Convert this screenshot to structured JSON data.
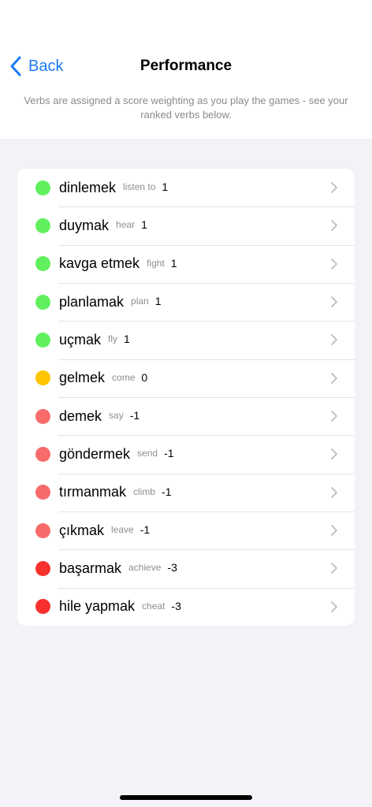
{
  "nav": {
    "back_label": "Back",
    "title": "Performance",
    "back_color": "#1a7cf5"
  },
  "description": "Verbs are assigned a score weighting as you play the games - see your ranked verbs below.",
  "colors": {
    "green": "#60f05d",
    "yellow": "#fdc500",
    "light_red": "#f76b6b",
    "red": "#f7302e"
  },
  "verbs": [
    {
      "verb": "dinlemek",
      "translation": "listen to",
      "score": "1",
      "color": "#60f05d"
    },
    {
      "verb": "duymak",
      "translation": "hear",
      "score": "1",
      "color": "#60f05d"
    },
    {
      "verb": "kavga etmek",
      "translation": "fight",
      "score": "1",
      "color": "#60f05d"
    },
    {
      "verb": "planlamak",
      "translation": "plan",
      "score": "1",
      "color": "#60f05d"
    },
    {
      "verb": "uçmak",
      "translation": "fly",
      "score": "1",
      "color": "#60f05d"
    },
    {
      "verb": "gelmek",
      "translation": "come",
      "score": "0",
      "color": "#fdc500"
    },
    {
      "verb": "demek",
      "translation": "say",
      "score": "-1",
      "color": "#f76b6b"
    },
    {
      "verb": "göndermek",
      "translation": "send",
      "score": "-1",
      "color": "#f76b6b"
    },
    {
      "verb": "tırmanmak",
      "translation": "climb",
      "score": "-1",
      "color": "#f76b6b"
    },
    {
      "verb": "çıkmak",
      "translation": "leave",
      "score": "-1",
      "color": "#f76b6b"
    },
    {
      "verb": "başarmak",
      "translation": "achieve",
      "score": "-3",
      "color": "#f7302e"
    },
    {
      "verb": "hile yapmak",
      "translation": "cheat",
      "score": "-3",
      "color": "#f7302e"
    }
  ],
  "icons": {
    "back": "chevron-left-icon",
    "row": "chevron-right-icon"
  }
}
